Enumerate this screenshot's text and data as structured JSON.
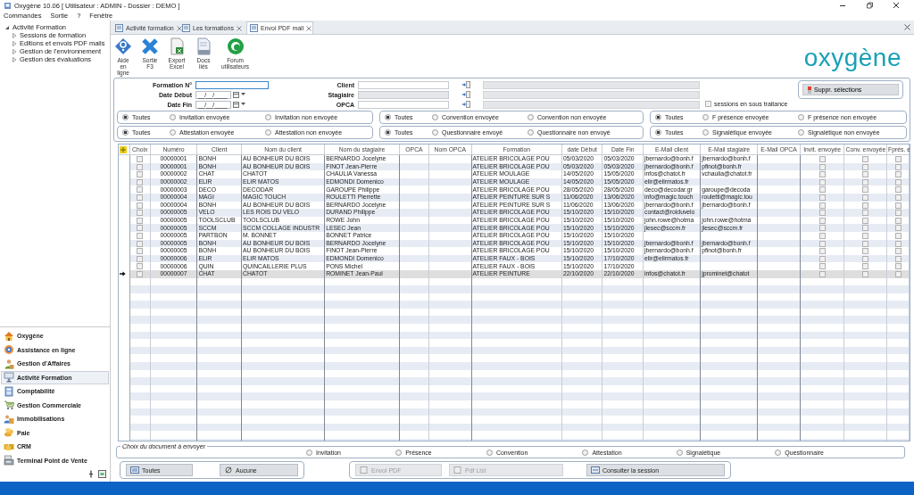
{
  "window": {
    "title": "Oxygène 10.06 [ Utilisateur : ADMIN - Dossier : DEMO ]"
  },
  "menu": [
    "Commandes",
    "Sortie",
    "?",
    "Fenêtre"
  ],
  "tree": [
    {
      "label": "Activité Formation",
      "expanded": true,
      "children": [
        {
          "label": "Sessions de formation",
          "expanded": false
        },
        {
          "label": "Editions et envois PDF mails",
          "expanded": false
        },
        {
          "label": "Gestion de l'environnement",
          "expanded": false
        },
        {
          "label": "Gestion des évaluations",
          "expanded": false
        }
      ]
    }
  ],
  "modules": [
    {
      "label": "Oxygène",
      "selected": false
    },
    {
      "label": "Assistance en ligne",
      "selected": false
    },
    {
      "label": "Gestion d'Affaires",
      "selected": false
    },
    {
      "label": "Activité Formation",
      "selected": true
    },
    {
      "label": "Comptabilité",
      "selected": false
    },
    {
      "label": "Gestion Commerciale",
      "selected": false
    },
    {
      "label": "Immobilisations",
      "selected": false
    },
    {
      "label": "Paie",
      "selected": false
    },
    {
      "label": "CRM",
      "selected": false
    },
    {
      "label": "Terminal Point de Vente",
      "selected": false
    }
  ],
  "tabs": [
    {
      "label": "Activité formation",
      "selected": false
    },
    {
      "label": "Les formations",
      "selected": false
    },
    {
      "label": "Envoi PDF mail",
      "selected": true
    }
  ],
  "toolbar": [
    "Aide en ligne",
    "Sortie F3",
    "Export Excel",
    "Docs liés",
    "Forum utilisateurs"
  ],
  "logo": "oxygène",
  "filters": {
    "fields": [
      {
        "label": "Formation N°",
        "kind": "text",
        "focused": true
      },
      {
        "label": "Date Début",
        "kind": "date",
        "value": "__/__/____"
      },
      {
        "label": "Date Fin",
        "kind": "date",
        "value": "__/__/____"
      }
    ],
    "lookups": [
      {
        "label": "Client",
        "disabled": false
      },
      {
        "label": "Stagiaire",
        "disabled": true
      },
      {
        "label": "OPCA",
        "disabled": false
      }
    ],
    "subcontract": {
      "label": "sessions en sous traitance",
      "checked": false
    },
    "clear_button": "Suppr. sélections"
  },
  "radio_groups": [
    {
      "options": [
        {
          "label": "Toutes",
          "selected": true
        },
        {
          "label": "Invitation envoyée",
          "selected": false
        },
        {
          "label": "Invitation non envoyée",
          "selected": false
        }
      ]
    },
    {
      "options": [
        {
          "label": "Toutes",
          "selected": true
        },
        {
          "label": "Convention envoyée",
          "selected": false
        },
        {
          "label": "Convention non envoyée",
          "selected": false
        }
      ]
    },
    {
      "options": [
        {
          "label": "Toutes",
          "selected": true
        },
        {
          "label": "F présence envoyée",
          "selected": false
        },
        {
          "label": "F présence non envoyée",
          "selected": false
        }
      ]
    },
    {
      "options": [
        {
          "label": "Toutes",
          "selected": true
        },
        {
          "label": "Attestation envoyée",
          "selected": false
        },
        {
          "label": "Attestation non envoyée",
          "selected": false
        }
      ]
    },
    {
      "options": [
        {
          "label": "Toutes",
          "selected": true
        },
        {
          "label": "Questionnaire envoyé",
          "selected": false
        },
        {
          "label": "Questionnaire non envoyé",
          "selected": false
        }
      ]
    },
    {
      "options": [
        {
          "label": "Toutes",
          "selected": true
        },
        {
          "label": "Signalétique envoyée",
          "selected": false
        },
        {
          "label": "Signalétique non envoyée",
          "selected": false
        }
      ]
    }
  ],
  "grid": {
    "columns": [
      "Choix",
      "Numéro",
      "Client",
      "Nom du client",
      "Nom du stagiaire",
      "OPCA",
      "Nom OPCA",
      "Formation",
      "date Début",
      "Date Fin",
      "E-Mail client",
      "E-Mail stagiaire",
      "E-Mail OPCA",
      "Invit. envoyée",
      "Conv. envoyée",
      "Fprés. e"
    ],
    "rows": [
      {
        "current": false,
        "chosen": false,
        "numero": "00000001",
        "client": "BONH",
        "client_name": "AU BONHEUR DU BOIS",
        "trainee": "BERNARDO Jocelyne",
        "course": "ATELIER BRICOLAGE POU",
        "start": "05/03/2020",
        "end": "05/03/2020",
        "client_email": "jbernardo@bonh.f",
        "trainee_email": "jbernardo@bonh.f",
        "invitation_sent": false,
        "convention_sent": false,
        "presence_sent": false
      },
      {
        "current": false,
        "chosen": false,
        "numero": "00000001",
        "client": "BONH",
        "client_name": "AU BONHEUR DU BOIS",
        "trainee": "FINOT Jean-Pierre",
        "course": "ATELIER BRICOLAGE POU",
        "start": "05/03/2020",
        "end": "05/03/2020",
        "client_email": "jbernardo@bonh.f",
        "trainee_email": "pfinot@bonh.fr",
        "invitation_sent": false,
        "convention_sent": false,
        "presence_sent": false
      },
      {
        "current": false,
        "chosen": false,
        "numero": "00000002",
        "client": "CHAT",
        "client_name": "CHATOT",
        "trainee": "CHAULIA Vanessa",
        "course": "ATELIER MOULAGE",
        "start": "14/05/2020",
        "end": "15/05/2020",
        "client_email": "infos@chatot.fr",
        "trainee_email": "vchaulia@chatot.fr",
        "invitation_sent": false,
        "convention_sent": false,
        "presence_sent": false
      },
      {
        "current": false,
        "chosen": false,
        "numero": "00000002",
        "client": "ELIR",
        "client_name": "ELIR MATOS",
        "trainee": "EDMONDI Domenico",
        "course": "ATELIER MOULAGE",
        "start": "14/05/2020",
        "end": "15/05/2020",
        "client_email": "elir@elirmatos.fr",
        "invitation_sent": false,
        "convention_sent": false,
        "presence_sent": false
      },
      {
        "current": false,
        "chosen": false,
        "numero": "00000003",
        "client": "DECO",
        "client_name": "DECODAR",
        "trainee": "GAROUPE Philippe",
        "course": "ATELIER BRICOLAGE POU",
        "start": "28/05/2020",
        "end": "28/05/2020",
        "client_email": "deco@decodar.gr",
        "trainee_email": "garoupe@decoda",
        "invitation_sent": false,
        "convention_sent": false,
        "presence_sent": false
      },
      {
        "current": false,
        "chosen": false,
        "numero": "00000004",
        "client": "MAGI",
        "client_name": "MAGIC TOUCH",
        "trainee": "ROULETTI Pierrette",
        "course": "ATELIER PEINTURE SUR S",
        "start": "11/06/2020",
        "end": "13/06/2020",
        "client_email": "info@magic.touch",
        "trainee_email": "rouletti@magic.tou",
        "invitation_sent": false,
        "convention_sent": false,
        "presence_sent": false
      },
      {
        "current": false,
        "chosen": false,
        "numero": "00000004",
        "client": "BONH",
        "client_name": "AU BONHEUR DU BOIS",
        "trainee": "BERNARDO Jocelyne",
        "course": "ATELIER PEINTURE SUR S",
        "start": "11/06/2020",
        "end": "13/06/2020",
        "client_email": "jbernardo@bonh.f",
        "trainee_email": "jbernardo@bonh.f",
        "invitation_sent": false,
        "convention_sent": false,
        "presence_sent": false
      },
      {
        "current": false,
        "chosen": false,
        "numero": "00000005",
        "client": "VELO",
        "client_name": "LES ROIS DU VELO",
        "trainee": "DURAND Philippe",
        "course": "ATELIER BRICOLAGE POU",
        "start": "15/10/2020",
        "end": "15/10/2020",
        "client_email": "contact@roiduvelo",
        "invitation_sent": false,
        "convention_sent": false,
        "presence_sent": false
      },
      {
        "current": false,
        "chosen": false,
        "numero": "00000005",
        "client": "TOOLSCLUB",
        "client_name": "TOOLSCLUB",
        "trainee": "ROWE John",
        "course": "ATELIER BRICOLAGE POU",
        "start": "15/10/2020",
        "end": "15/10/2020",
        "client_email": "john.rowe@hotma",
        "trainee_email": "john.rowe@hotma",
        "invitation_sent": false,
        "convention_sent": false,
        "presence_sent": false
      },
      {
        "current": false,
        "chosen": false,
        "numero": "00000005",
        "client": "SCCM",
        "client_name": "SCCM COLLAGE INDUSTR",
        "trainee": "LESEC Jean",
        "course": "ATELIER BRICOLAGE POU",
        "start": "15/10/2020",
        "end": "15/10/2020",
        "client_email": "jlesec@sccm.fr",
        "trainee_email": "jlesec@sccm.fr",
        "invitation_sent": false,
        "convention_sent": false,
        "presence_sent": false
      },
      {
        "current": false,
        "chosen": false,
        "numero": "00000005",
        "client": "PARTBON",
        "client_name": "M. BONNET",
        "trainee": "BONNET Patrice",
        "course": "ATELIER BRICOLAGE POU",
        "start": "15/10/2020",
        "end": "15/10/2020",
        "invitation_sent": false,
        "convention_sent": false,
        "presence_sent": false
      },
      {
        "current": false,
        "chosen": false,
        "numero": "00000005",
        "client": "BONH",
        "client_name": "AU BONHEUR DU BOIS",
        "trainee": "BERNARDO Jocelyne",
        "course": "ATELIER BRICOLAGE POU",
        "start": "15/10/2020",
        "end": "15/10/2020",
        "client_email": "jbernardo@bonh.f",
        "trainee_email": "jbernardo@bonh.f",
        "invitation_sent": false,
        "convention_sent": false,
        "presence_sent": false
      },
      {
        "current": false,
        "chosen": false,
        "numero": "00000005",
        "client": "BONH",
        "client_name": "AU BONHEUR DU BOIS",
        "trainee": "FINOT Jean-Pierre",
        "course": "ATELIER BRICOLAGE POU",
        "start": "15/10/2020",
        "end": "15/10/2020",
        "client_email": "jbernardo@bonh.f",
        "trainee_email": "pfinot@bonh.fr",
        "invitation_sent": false,
        "convention_sent": false,
        "presence_sent": false
      },
      {
        "current": false,
        "chosen": false,
        "numero": "00000006",
        "client": "ELIR",
        "client_name": "ELIR MATOS",
        "trainee": "EDMONDI Domenico",
        "course": "ATELIER FAUX - BOIS",
        "start": "15/10/2020",
        "end": "17/10/2020",
        "client_email": "elir@elirmatos.fr",
        "invitation_sent": false,
        "convention_sent": false,
        "presence_sent": false
      },
      {
        "current": false,
        "chosen": false,
        "numero": "00000006",
        "client": "QUIN",
        "client_name": "QUINCAILLERIE PLUS",
        "trainee": "PONS Michel",
        "course": "ATELIER FAUX - BOIS",
        "start": "15/10/2020",
        "end": "17/10/2020",
        "invitation_sent": false,
        "convention_sent": false,
        "presence_sent": false
      },
      {
        "current": true,
        "chosen": false,
        "numero": "00000007",
        "client": "CHAT",
        "client_name": "CHATOT",
        "trainee": "ROMINET Jean-Paul",
        "course": "ATELIER PEINTURE",
        "start": "22/10/2020",
        "end": "22/10/2020",
        "client_email": "infos@chatot.fr",
        "trainee_email": "jprominet@chatot",
        "invitation_sent": false,
        "convention_sent": false,
        "presence_sent": false
      }
    ]
  },
  "document_choice": {
    "title": "Choix du document à envoyer",
    "options": [
      {
        "label": "Invitation",
        "selected": false
      },
      {
        "label": "Présence",
        "selected": false
      },
      {
        "label": "Convention",
        "selected": false
      },
      {
        "label": "Attestation",
        "selected": false
      },
      {
        "label": "Signalétique",
        "selected": false
      },
      {
        "label": "Questionnaire",
        "selected": false
      }
    ]
  },
  "buttons": [
    {
      "label": "Toutes",
      "disabled": false
    },
    {
      "label": "Aucune",
      "disabled": false
    },
    {
      "label": "Envoi PDF",
      "disabled": true
    },
    {
      "label": "Pdf List",
      "disabled": true
    },
    {
      "label": "Consulter la session",
      "disabled": false
    }
  ]
}
